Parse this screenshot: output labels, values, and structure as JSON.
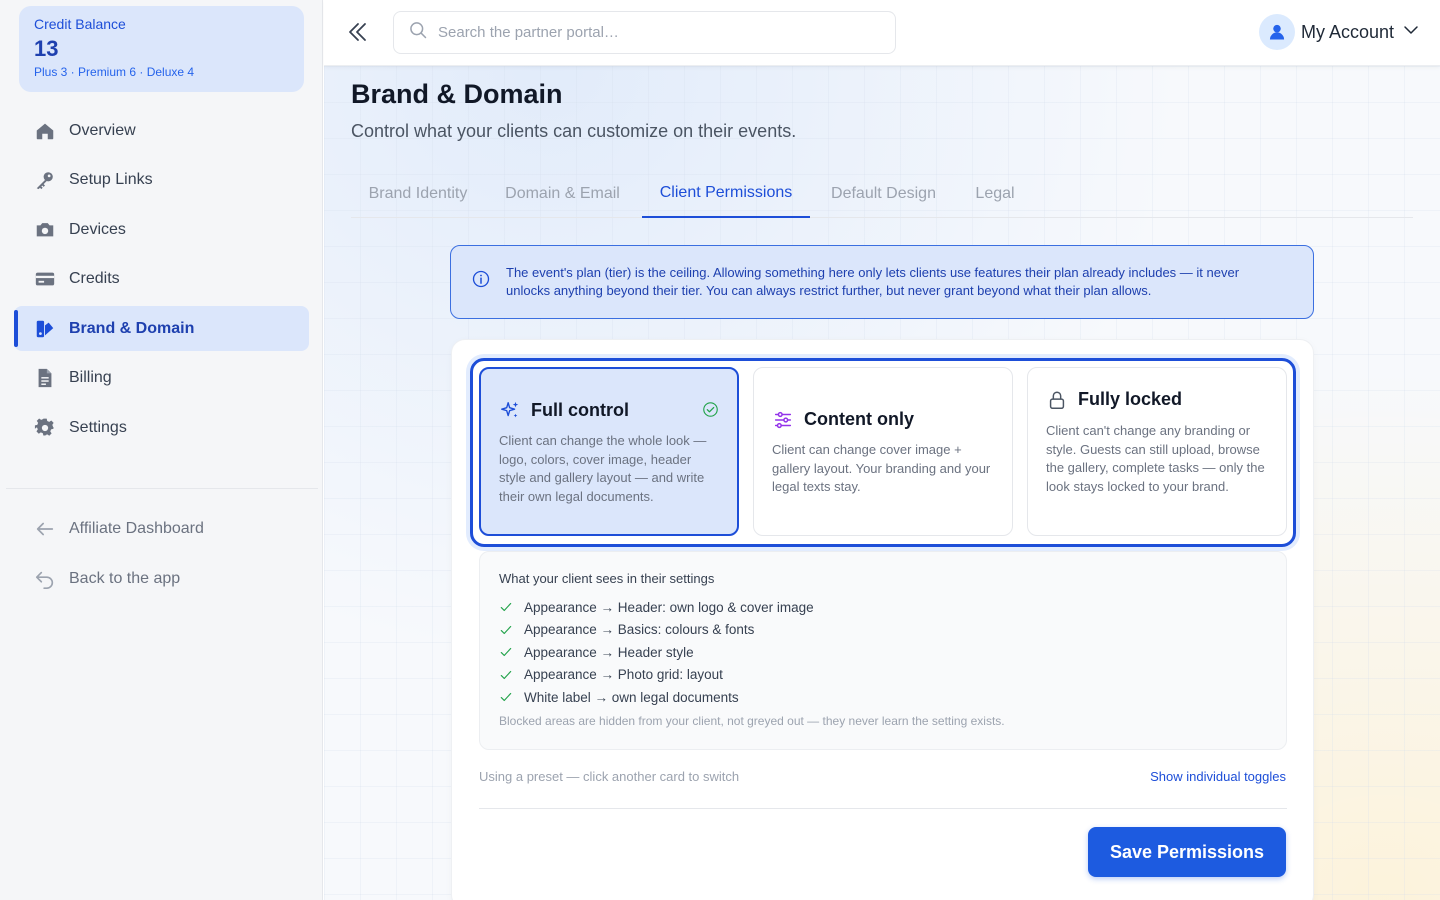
{
  "credit": {
    "title": "Credit Balance",
    "value": "13",
    "breakdown": "Plus 3 · Premium 6 · Deluxe 4"
  },
  "sidebar": {
    "items": [
      {
        "label": "Overview",
        "icon": "home-icon"
      },
      {
        "label": "Setup Links",
        "icon": "key-icon"
      },
      {
        "label": "Devices",
        "icon": "camera-icon"
      },
      {
        "label": "Credits",
        "icon": "credit-card-icon"
      },
      {
        "label": "Brand & Domain",
        "icon": "brand-icon",
        "active": true
      },
      {
        "label": "Billing",
        "icon": "document-icon"
      },
      {
        "label": "Settings",
        "icon": "gear-icon"
      }
    ],
    "secondary": [
      {
        "label": "Affiliate Dashboard",
        "icon": "arrow-left-icon"
      },
      {
        "label": "Back to the app",
        "icon": "return-icon"
      }
    ]
  },
  "topbar": {
    "search_placeholder": "Search the partner portal…",
    "account_label": "My Account"
  },
  "page": {
    "title": "Brand & Domain",
    "subtitle": "Control what your clients can customize on their events."
  },
  "tabs": [
    {
      "label": "Brand Identity"
    },
    {
      "label": "Domain & Email"
    },
    {
      "label": "Client Permissions",
      "active": true
    },
    {
      "label": "Default Design"
    },
    {
      "label": "Legal"
    }
  ],
  "info": {
    "text": "The event's plan (tier) is the ceiling. Allowing something here only lets clients use features their plan already includes — it never unlocks anything beyond their tier. You can always restrict further, but never grant beyond what their plan allows."
  },
  "presets": [
    {
      "title": "Full control",
      "icon": "sparkles-icon",
      "selected": true,
      "desc": "Client can change the whole look — logo, colors, cover image, header style and gallery layout — and write their own legal documents."
    },
    {
      "title": "Content only",
      "icon": "sliders-icon",
      "selected": false,
      "desc": "Client can change cover image + gallery layout. Your branding and your legal texts stay."
    },
    {
      "title": "Fully locked",
      "icon": "lock-icon",
      "selected": false,
      "desc": "Client can't change any branding or style. Guests can still upload, browse the gallery, complete tasks — only the look stays locked to your brand."
    }
  ],
  "sees": {
    "title": "What your client sees in their settings",
    "items": [
      "Appearance → Header: own logo & cover image",
      "Appearance → Basics: colours & fonts",
      "Appearance → Header style",
      "Appearance → Photo grid: layout",
      "White label → own legal documents"
    ],
    "note": "Blocked areas are hidden from your client, not greyed out — they never learn the setting exists."
  },
  "footer": {
    "preset_hint": "Using a preset — click another card to switch",
    "toggle_link": "Show individual toggles",
    "save_label": "Save Permissions"
  },
  "colors": {
    "accent": "#1d4ed8",
    "accent_light": "#dbe6fb",
    "success": "#22a34a"
  }
}
